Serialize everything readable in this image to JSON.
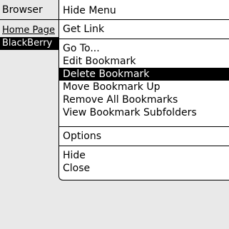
{
  "background": {
    "title": "Browser",
    "items": [
      "Home Page",
      "BlackBerry"
    ]
  },
  "menu": {
    "items": [
      {
        "label": "Hide Menu"
      },
      {
        "label": "Get Link"
      },
      {
        "label": "Go To..."
      },
      {
        "label": "Edit Bookmark"
      },
      {
        "label": "Delete Bookmark",
        "selected": true
      },
      {
        "label": "Move Bookmark Up"
      },
      {
        "label": "Remove All Bookmarks"
      },
      {
        "label": "View Bookmark Subfolders"
      },
      {
        "label": "Options"
      },
      {
        "label": "Hide"
      },
      {
        "label": "Close"
      }
    ]
  }
}
